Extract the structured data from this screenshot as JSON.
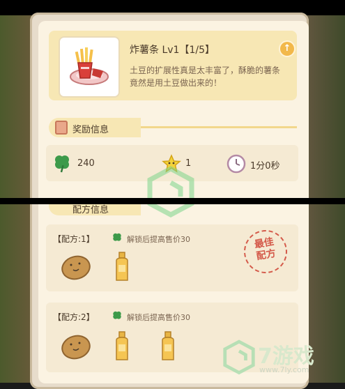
{
  "item": {
    "title": "炸薯条 Lv1【1/5】",
    "description": "土豆的扩展性真是太丰富了，酥脆的薯条竟然是用土豆做出来的！",
    "icon": "fries-plate-icon",
    "upgrade_icon": "arrow-up-icon"
  },
  "reward_section": {
    "label": "奖励信息",
    "stats": [
      {
        "icon": "clover-icon",
        "value": "240"
      },
      {
        "icon": "star-icon",
        "value": "1"
      },
      {
        "icon": "clock-icon",
        "value": "1分0秒"
      }
    ]
  },
  "recipe_section": {
    "label": "配方信息"
  },
  "recipes": [
    {
      "label": "【配方:1】",
      "hint": "解锁后提高售价30",
      "ingredients": [
        "potato-icon",
        "oil-bottle-icon"
      ],
      "stamp": [
        "最佳",
        "配方"
      ]
    },
    {
      "label": "【配方:2】",
      "hint": "解锁后提高售价30",
      "ingredients": [
        "potato-icon",
        "oil-bottle-icon",
        "oil-bottle-icon"
      ]
    }
  ],
  "watermark": {
    "brand": "7游戏",
    "url": "www.7ly.com"
  },
  "colors": {
    "panel": "#fbf3e2",
    "card_yellow": "#f7e7b4",
    "clover_green": "#3d9a4a",
    "stamp_red": "#d45a4a",
    "text_dark": "#4a3a2a"
  }
}
